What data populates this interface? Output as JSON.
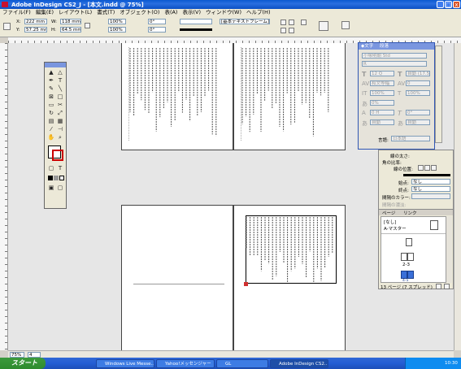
{
  "window": {
    "title": "Adobe InDesign CS2_J - [本文.indd @ 75%]",
    "controls": [
      "_",
      "□",
      "x"
    ]
  },
  "menu": [
    "ファイル(F)",
    "編集(E)",
    "レイアウト(L)",
    "書式(T)",
    "オブジェクト(O)",
    "表(A)",
    "表示(V)",
    "ウィンドウ(W)",
    "ヘルプ(H)"
  ],
  "controlbar": {
    "x_label": "X:",
    "x_value": "222 mm",
    "y_label": "Y:",
    "y_value": "57.25 mm",
    "w_label": "W:",
    "w_value": "118 mm",
    "h_label": "H:",
    "h_value": "64.5 mm",
    "scale_x": "100%",
    "scale_y": "100%",
    "angle": "0°",
    "shear": "0°",
    "frame_label": "[基本テキストフレーム]",
    "stroke_weight": ""
  },
  "char_panel": {
    "tabs": [
      "◆文字",
      "段落"
    ],
    "font": "小塚明朝 Std",
    "style": "R",
    "size": "12 Q",
    "leading": "自動 (17.5 H)",
    "tracking": "0",
    "kerning": "和文等幅",
    "vscale": "100%",
    "hscale": "100%",
    "tsume": "0%",
    "baseline": "0 H",
    "skew": "0°",
    "aki1": "自動",
    "aki2": "自動",
    "language_label": "言語:",
    "language": "日本語"
  },
  "stroke_panel": {
    "weight_label": "線の太さ:",
    "corner_label": "角の比率:",
    "type_label": "線の位置:",
    "start_label": "始点:",
    "start_value": "なし",
    "end_label": "終点:",
    "end_value": "なし",
    "gap_label": "間隔のカラー:",
    "gap_tint_label": "間隔の濃淡:"
  },
  "pages_panel": {
    "tabs": [
      "ページ",
      "リンク"
    ],
    "none_master": "[なし]",
    "a_master": "A-マスター",
    "spread_label": "2-3",
    "last_spread": "4-5",
    "status": "13 ページ (7 スプレッド)"
  },
  "statusbar": {
    "zoom": "75%",
    "page": "4"
  },
  "taskbar": {
    "start": "スタート",
    "items": [
      "Windows Live Messe...",
      "Yahoo!メッセンジャー",
      "GL",
      "Adobe InDesign CS2..."
    ],
    "clock": "10:30"
  },
  "colors": {
    "titlebar": "#0a58d0",
    "panel_border": "#3056b4",
    "selected_frame": "#000000",
    "page_arrow": "#d03030"
  }
}
